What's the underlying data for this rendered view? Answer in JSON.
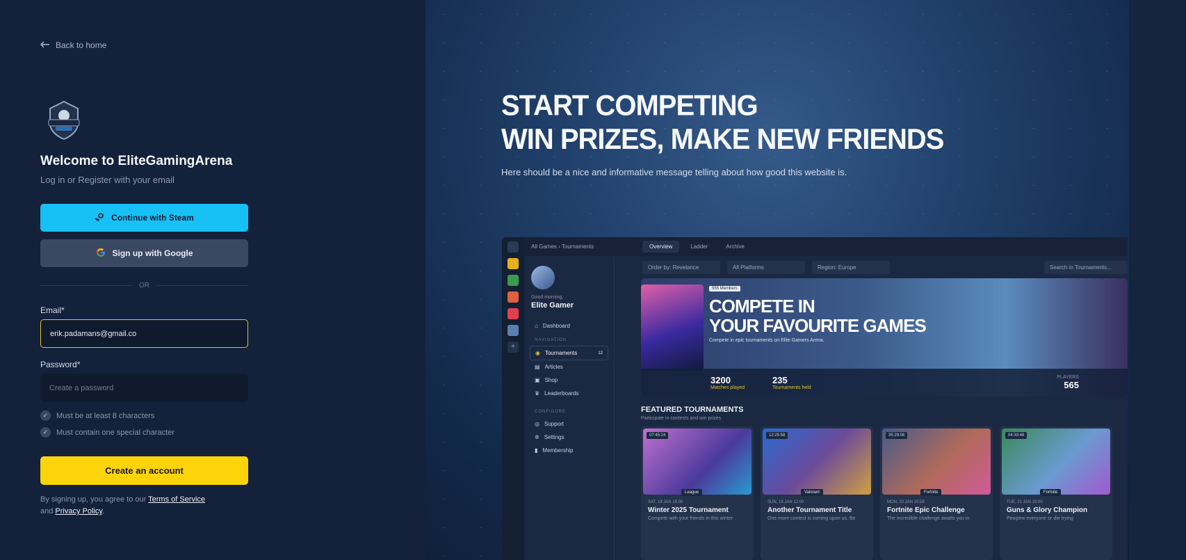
{
  "nav": {
    "back_label": "Back to home"
  },
  "brand": {
    "logo_alt": "GAMERS ARENA"
  },
  "auth": {
    "title": "Welcome to EliteGamingArena",
    "subtitle": "Log in or Register with your email",
    "steam_label": "Continue with Steam",
    "google_label": "Sign up with Google",
    "or_label": "OR",
    "email_label": "Email*",
    "email_value": "erik.padamans@gmail.co",
    "password_label": "Password*",
    "password_placeholder": "Create a password",
    "rules": [
      "Must be at least 8 characters",
      "Must contain one special character"
    ],
    "create_label": "Create an account",
    "terms_prefix": "By signing up, you agree to our",
    "terms_link": "Terms of Service",
    "terms_and": "and",
    "privacy_link": "Privacy Policy",
    "terms_end": "."
  },
  "hero": {
    "line1": "START COMPETING",
    "line2": "WIN PRIZES, MAKE NEW FRIENDS",
    "message": "Here should be a nice and informative message telling about how good this website is."
  },
  "preview": {
    "breadcrumb": "All Games › Tournaments",
    "tabs": [
      "Overview",
      "Ladder",
      "Archive"
    ],
    "greeting": "Good morning,",
    "username": "Elite Gamer",
    "dashboard": "Dashboard",
    "nav_head": "NAVIGATION",
    "nav": [
      {
        "label": "Tournaments",
        "count": "12"
      },
      {
        "label": "Articles"
      },
      {
        "label": "Shop"
      },
      {
        "label": "Leaderboards"
      }
    ],
    "config_head": "CONFIGURE",
    "config": [
      "Support",
      "Settings",
      "Membership"
    ],
    "filters": [
      "Order by: Revelance",
      "All Platforms",
      "Region: Europe"
    ],
    "search_placeholder": "Search in Tournaments...",
    "banner": {
      "badge": "555 Members",
      "title1": "COMPETE IN",
      "title2": "YOUR FAVOURITE GAMES",
      "sub": "Compete in epic tournaments on Elite Gamers Arena.",
      "stat1_value": "3200",
      "stat1_label": "Matches played",
      "stat2_value": "235",
      "stat2_label": "Tournaments held",
      "players_label": "PLAYERS",
      "players_value": "565"
    },
    "featured_title": "FEATURED TOURNAMENTS",
    "featured_sub": "Participate in contests and win prizes",
    "cards": [
      {
        "time": "07:45:24",
        "game": "League",
        "date": "SAT, 18 JAN 15:00",
        "title": "Winter 2025 Tournament",
        "desc": "Compete with your friends in this winter"
      },
      {
        "time": "12:25:58",
        "game": "Valorant",
        "date": "SUN, 19 JAN 12:00",
        "title": "Another Tournament Title",
        "desc": "One more contest is coming upon us. Be"
      },
      {
        "time": "35:29:06",
        "game": "Fortnite",
        "date": "MON, 20 JAN 15:58",
        "title": "Fortnite Epic Challenge",
        "desc": "The incredible challenge awaits you in"
      },
      {
        "time": "04:33:48",
        "game": "Fortnite",
        "date": "TUE, 21 JAN 15:00",
        "title": "Guns & Glory Champion",
        "desc": "Pewpew everyone or die trying"
      }
    ]
  },
  "colors": {
    "steam": "#17c1f5",
    "create": "#fdd40a",
    "accent": "#e0c52a"
  }
}
